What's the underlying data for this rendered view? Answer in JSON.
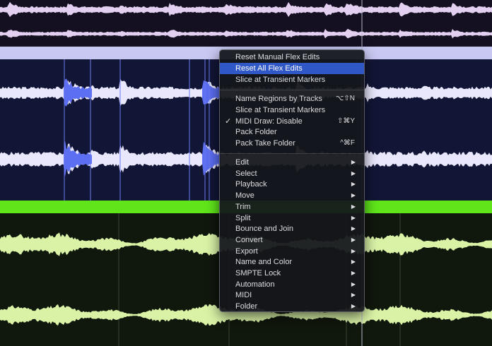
{
  "menu": {
    "group1": [
      "Reset Manual Flex Edits",
      "Reset All Flex Edits",
      "Slice at Transient Markers"
    ],
    "highlighted_item": "Reset All Flex Edits",
    "group2": [
      {
        "label": "Name Regions by Tracks",
        "shortcut": "⌥⇧N",
        "checked": false
      },
      {
        "label": "Slice at Transient Markers",
        "shortcut": "",
        "checked": false
      },
      {
        "label": "MIDI Draw: Disable",
        "shortcut": "⇧⌘Y",
        "checked": true
      },
      {
        "label": "Pack Folder",
        "shortcut": "",
        "checked": false
      },
      {
        "label": "Pack Take Folder",
        "shortcut": "^⌘F",
        "checked": false
      }
    ],
    "check_glyph": "✓",
    "submenu_arrow": "▶",
    "group3": [
      "Edit",
      "Select",
      "Playback",
      "Move",
      "Trim",
      "Split",
      "Bounce and Join",
      "Convert",
      "Export",
      "Name and Color",
      "SMPTE Lock",
      "Automation",
      "MIDI",
      "Folder"
    ]
  },
  "colors": {
    "top_waveform": "#e3d0f0",
    "mid_waveform": "#e9e7fb",
    "flex_waveform": "#5c6ef2",
    "header_bar_lavender": "#c9c8f2",
    "header_bar_green": "#5fe51a",
    "bottom_waveform": "#d9f2a6",
    "menu_highlight": "#2f58c6"
  }
}
